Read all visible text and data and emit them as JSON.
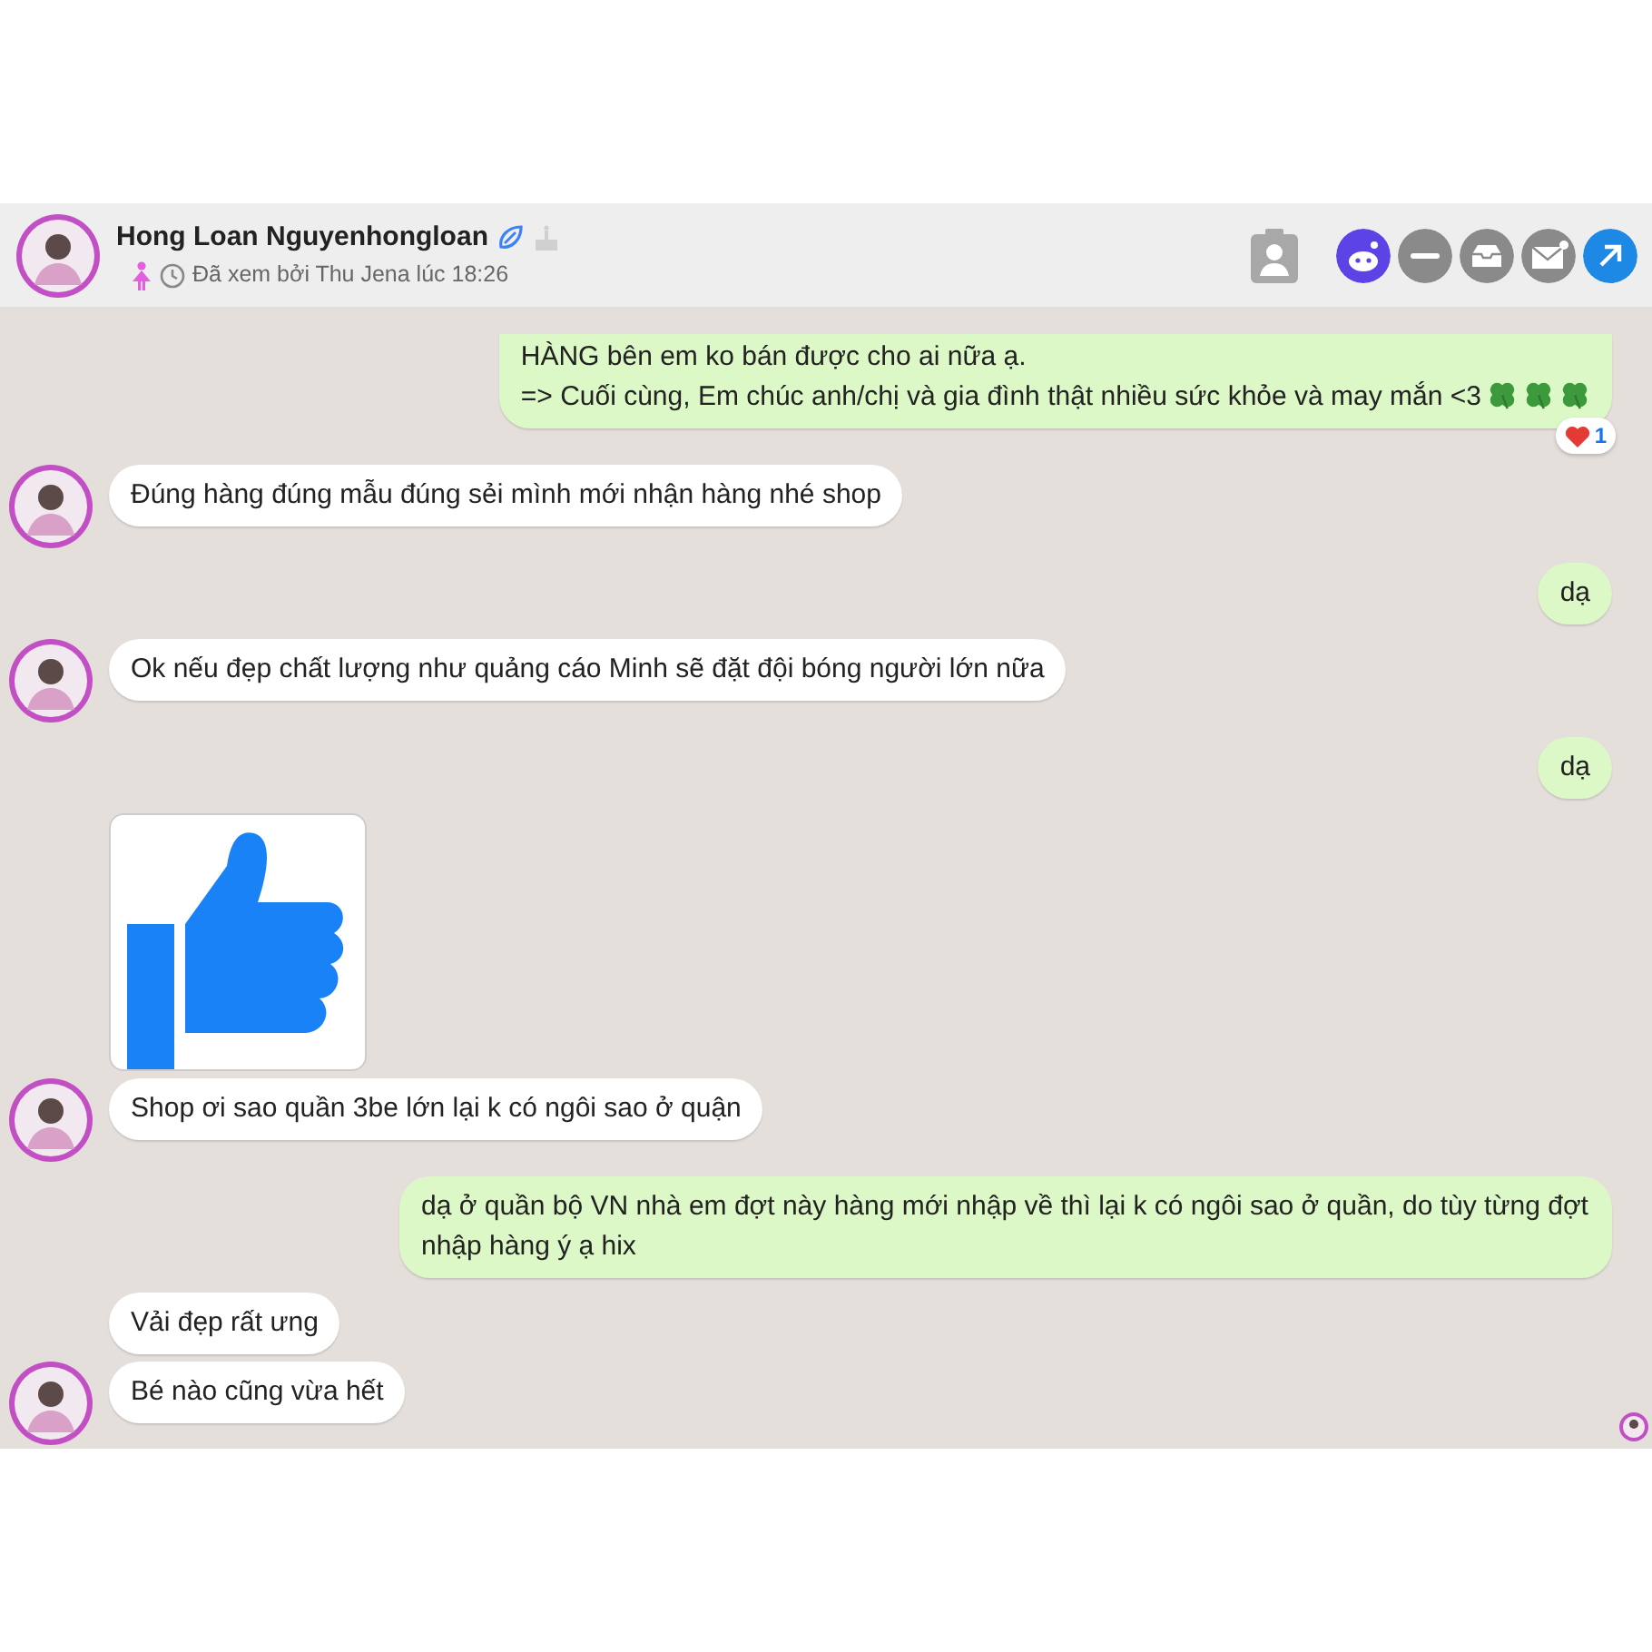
{
  "header": {
    "name": "Hong Loan Nguyenhongloan",
    "seen": "Đã xem bởi Thu Jena lúc 18:26"
  },
  "messages": [
    {
      "kind": "sent",
      "lines": [
        "HÀNG bên em ko bán được cho ai nữa ạ.",
        "=> Cuối cùng, Em chúc anh/chị và gia đình thật nhiều sức khỏe và may mắn <3"
      ],
      "emojis": [
        {
          "kind": "clover"
        },
        {
          "kind": "clover"
        },
        {
          "kind": "clover"
        }
      ],
      "reaction": "1"
    },
    {
      "kind": "received",
      "avatar": true,
      "lines": [
        "Đúng hàng đúng mẫu đúng sẻi mình mới nhận hàng nhé shop"
      ]
    },
    {
      "kind": "sent",
      "lines": [
        "dạ"
      ]
    },
    {
      "kind": "received",
      "avatar": true,
      "lines": [
        "Ok nếu đẹp chất lượng như quảng cáo Minh sẽ đặt đội bóng người lớn nữa"
      ]
    },
    {
      "kind": "sent",
      "lines": [
        "dạ"
      ]
    },
    {
      "kind": "sticker"
    },
    {
      "kind": "received",
      "avatar": true,
      "lines": [
        "Shop ơi sao quần 3be lớn lại k có ngôi sao ở quận"
      ]
    },
    {
      "kind": "sent",
      "lines": [
        "dạ ở quần bộ VN nhà em đợt này hàng mới nhập về thì lại k có ngôi sao ở quần, do tùy từng đợt nhập hàng ý ạ hix"
      ]
    },
    {
      "kind": "received",
      "avatar": false,
      "lines": [
        "Vải đẹp rất ưng"
      ]
    },
    {
      "kind": "received",
      "avatar": true,
      "lines": [
        "Bé nào cũng vừa hết"
      ]
    }
  ]
}
